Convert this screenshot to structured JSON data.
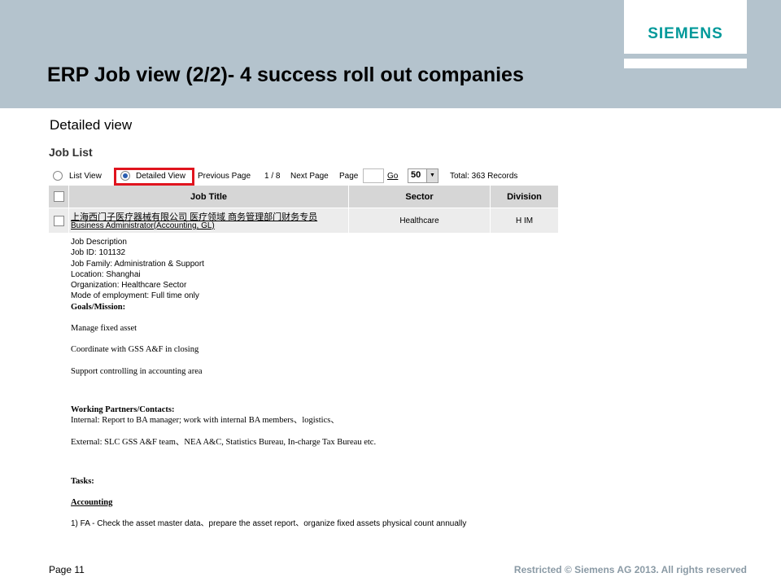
{
  "slide": {
    "title": "ERP Job view (2/2)- 4 success roll out companies",
    "subtitle": "Detailed view",
    "logo": "SIEMENS",
    "page_label": "Page 11",
    "footer": "Restricted © Siemens AG 2013. All rights reserved",
    "colors": {
      "header_bg": "#b4c3cd",
      "logo": "#00999a",
      "highlight": "#e0141e"
    }
  },
  "job_list": {
    "title": "Job List",
    "toolbar": {
      "list_view": "List View",
      "detailed_view": "Detailed View",
      "previous_page": "Previous Page",
      "page_counter": "1 / 8",
      "next_page": "Next Page",
      "page_label": "Page",
      "go": "Go",
      "per_page": "50",
      "total": "Total: 363 Records"
    },
    "columns": [
      "Job Title",
      "Sector",
      "Division"
    ],
    "row": {
      "title_cn": "上海西门子医疗器械有限公司 医疗领域 商务管理部门财务专员",
      "title_en": "Business Administrator(Accounting, GL)",
      "sector": "Healthcare",
      "division": "H IM"
    },
    "details": {
      "heading": "Job Description",
      "job_id": "Job ID: 101132",
      "job_family": "Job Family: Administration & Support",
      "location": "Location: Shanghai",
      "organization": "Organization: Healthcare Sector",
      "mode": "Mode of employment: Full time only",
      "goals_heading": "Goals/Mission:",
      "goal1": "Manage fixed asset",
      "goal2": "Coordinate with GSS A&F in closing",
      "goal3": "Support controlling in accounting area",
      "partners_heading": "Working Partners/Contacts:",
      "internal": "Internal: Report to BA manager; work with internal BA members、logistics、",
      "external": "External: SLC GSS A&F team、NEA A&C, Statistics Bureau, In-charge Tax Bureau etc.",
      "tasks_heading": "Tasks:",
      "accounting_heading": "Accounting",
      "task1": "1) FA - Check the asset master data、prepare the asset report、organize fixed assets physical count annually"
    }
  }
}
